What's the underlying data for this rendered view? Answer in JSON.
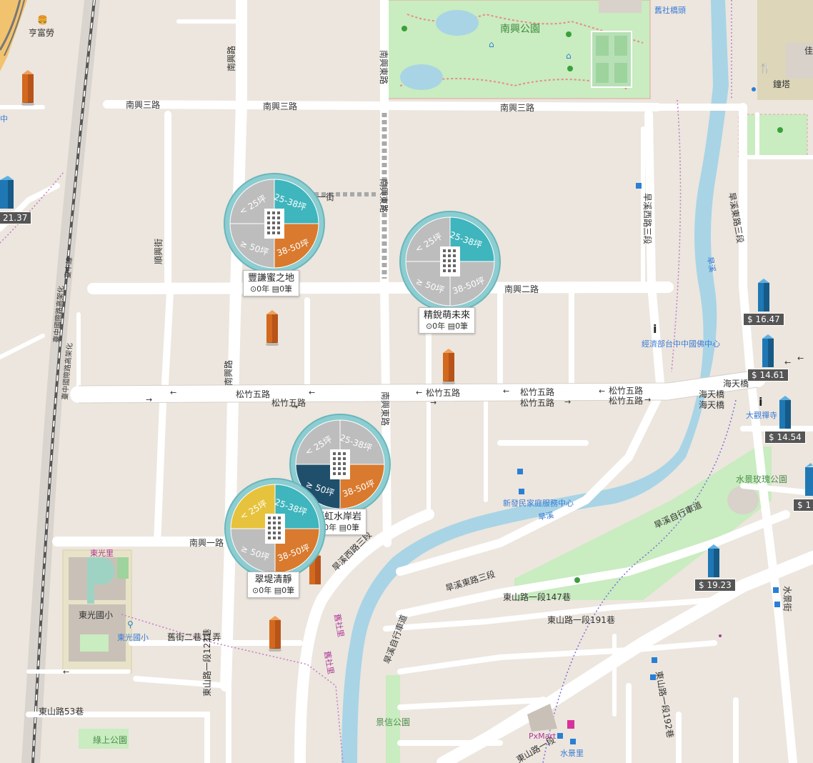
{
  "roads": {
    "nanxing_3rd_a": "南興三路",
    "nanxing_3rd_b": "南興三路",
    "nanxing_3rd_c": "南興三路",
    "nanxing_2nd": "南興二路",
    "nanxing_1st": "南興一路",
    "nanxing_road": "南興路",
    "nanxing_road_b": "南興路",
    "shunxing_st": "順興街",
    "nanxing_dong_a": "南興東路",
    "nanxing_dong_b": "南興東路",
    "nanxing_dong_c": "南興東路",
    "songzhu_5th_a": "松竹五路",
    "songzhu_5th_b": "松竹五路",
    "songzhu_5th_c": "松竹五路",
    "songzhu_5th_d": "松竹五路",
    "songzhu_5th_e": "松竹五路",
    "songzhu_5th_f": "松竹五路",
    "songzhu_5th_g": "松竹五路",
    "hanxi_west_3": "旱溪西路三段",
    "hanxi_west_3b": "旱溪西路三段",
    "hanxi_east_3": "旱溪東路三段",
    "hanxi_east_3b": "旱溪東路三段",
    "hanxi_bike_a": "旱溪自行車道",
    "hanxi_bike_b": "旱溪自行車道",
    "dongshan_147": "東山路一段147巷",
    "dongshan_191": "東山路一段191巷",
    "dongshan_192": "東山路一段192巷",
    "dongshan_123": "東山路一段123巷",
    "dongshan_53": "東山路53巷",
    "dongshan_1": "東山路一段",
    "jiujie_2_11": "舊街二巷11弄",
    "haitian_a": "海天橋",
    "haitian_b": "海天橋",
    "haitian_c": "海天橋",
    "shuijing_st": "水景街",
    "rail_a": "臺中線",
    "rail_b": "臺中國際路高架化",
    "rail_c": "臺中國際路高架化",
    "hanxi": "旱溪",
    "hanxi_b": "旱溪",
    "jiushe_li": "舊社里",
    "jiushe_li_b": "舊社里",
    "yi_jie": "一街",
    "jiushe_bridge": "舊社橋頭"
  },
  "places": {
    "nanxing_park": "南興公園",
    "shuijing_park": "水景玫瑰公園",
    "jingxin_park": "景信公園",
    "lushang_park": "綠上公園",
    "dongguang_school": "東光國小",
    "dongguang_school_b": "東光國小",
    "dongguang_li": "東光里",
    "xinfa_center": "新發民家庭服務中心",
    "temple_center": "經濟部台中中國佛中心",
    "daguan_temple": "大觀禪寺",
    "pxmart": "PxMart",
    "shuijing_li": "水景里",
    "zhonglou": "鐘塔",
    "hengfu": "亨富勞",
    "zhong": "中",
    "jia": "佳"
  },
  "clusters": [
    {
      "name": "豐謙蜜之地",
      "meta_year": "0年",
      "meta_count": "0筆",
      "segments": [
        {
          "label": "< 25坪",
          "color": "#bdbdbd"
        },
        {
          "label": "25-38坪",
          "color": "#3fb5bd"
        },
        {
          "label": "38-50坪",
          "color": "#d97a2e"
        },
        {
          "label": "≥ 50坪",
          "color": "#bdbdbd"
        }
      ]
    },
    {
      "name": "精銳萌未來",
      "meta_year": "0年",
      "meta_count": "0筆",
      "segments": [
        {
          "label": "< 25坪",
          "color": "#bdbdbd"
        },
        {
          "label": "25-38坪",
          "color": "#3fb5bd"
        },
        {
          "label": "38-50坪",
          "color": "#bdbdbd"
        },
        {
          "label": "≥ 50坪",
          "color": "#bdbdbd"
        }
      ]
    },
    {
      "name": "鉅虹水岸岩",
      "meta_year": "0年",
      "meta_count": "0筆",
      "segments": [
        {
          "label": "< 25坪",
          "color": "#bdbdbd"
        },
        {
          "label": "25-38坪",
          "color": "#bdbdbd"
        },
        {
          "label": "38-50坪",
          "color": "#d97a2e"
        },
        {
          "label": "≥ 50坪",
          "color": "#1f4f6b"
        }
      ]
    },
    {
      "name": "翠堤清靜",
      "meta_year": "0年",
      "meta_count": "0筆",
      "segments": [
        {
          "label": "< 25坪",
          "color": "#e7c23c"
        },
        {
          "label": "25-38坪",
          "color": "#3fb5bd"
        },
        {
          "label": "38-50坪",
          "color": "#d97a2e"
        },
        {
          "label": "≥ 50坪",
          "color": "#bdbdbd"
        }
      ]
    }
  ],
  "price_tags": [
    {
      "text": "21.37"
    },
    {
      "text": "$ 16.47"
    },
    {
      "text": "$ 14.61"
    },
    {
      "text": "$ 14.54"
    },
    {
      "text": "$ 1"
    },
    {
      "text": "$ 19.23"
    }
  ],
  "colors": {
    "land": "#ece6de",
    "road": "#ffffff",
    "park": "#c9ecc0",
    "river": "#a8d4e6",
    "building_orange": "#d2691e",
    "building_blue": "#1f78b4",
    "teal_ring": "#7ac3c8"
  }
}
